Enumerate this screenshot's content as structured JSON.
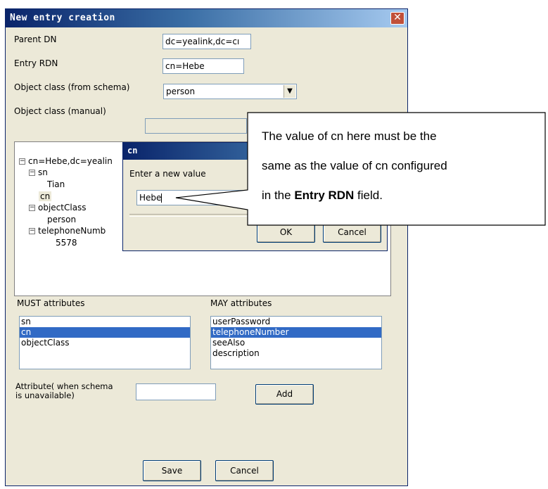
{
  "window": {
    "title": "New entry creation",
    "close_glyph": "✕"
  },
  "form": {
    "parent_dn_label": "Parent DN",
    "parent_dn_value": "dc=yealink,dc=cı",
    "entry_rdn_label": "Entry RDN",
    "entry_rdn_value": "cn=Hebe",
    "object_class_schema_label": "Object class (from schema)",
    "object_class_schema_value": "person",
    "object_class_manual_label": "Object class (manual)",
    "object_class_manual_value": ""
  },
  "tree": {
    "root": "cn=Hebe,dc=yealin",
    "sn": "sn",
    "sn_value": "Tian",
    "cn": "cn",
    "objectClass": "objectClass",
    "objectClass_value": "person",
    "telephoneNumber": "telephoneNumb",
    "telephoneNumber_value": "5578"
  },
  "must": {
    "label": "MUST attributes",
    "items": [
      "sn",
      "cn",
      "objectClass"
    ],
    "selected": "cn"
  },
  "may": {
    "label": "MAY attributes",
    "items": [
      "userPassword",
      "telephoneNumber",
      "seeAlso",
      "description"
    ],
    "selected": "telephoneNumber"
  },
  "attribute": {
    "label": "Attribute( when schema is unavailable)",
    "label_line1": "Attribute( when schema",
    "label_line2": "is unavailable)",
    "value": "",
    "add_label": "Add"
  },
  "footer": {
    "save_label": "Save",
    "cancel_label": "Cancel"
  },
  "dialog": {
    "title": "cn",
    "prompt": "Enter a new value",
    "value": "Hebe",
    "ok_label": "OK",
    "cancel_label": "Cancel"
  },
  "callout": {
    "line1": "The value of cn here must be the",
    "line2": "same as the value of cn configured",
    "line3_pre": "in the ",
    "line3_bold": "Entry RDN",
    "line3_post": " field."
  },
  "icons": {
    "expand": "minus-box-icon",
    "dropdown": "chevron-down-icon",
    "close": "close-icon"
  },
  "colors": {
    "title_bar": "#0a246a",
    "selection": "#316ac5",
    "window_bg": "#ece9d8",
    "close_button": "#c0503a"
  }
}
